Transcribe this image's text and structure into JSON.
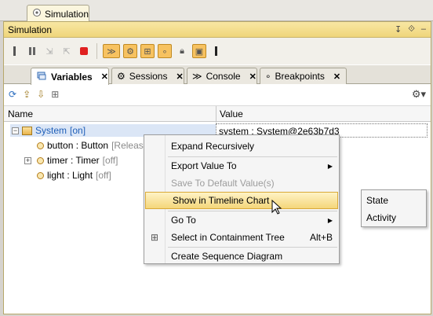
{
  "doc_tab": {
    "label": "Simulation",
    "icon": "simulation-icon"
  },
  "panel": {
    "title": "Simulation",
    "title_icons": [
      "pin-icon",
      "restore-icon",
      "minimize-icon"
    ]
  },
  "toolbar": {
    "buttons": [
      "step-back",
      "pause",
      "step-into",
      "step-over",
      "stop",
      "auto-animate",
      "animate",
      "trigger",
      "scenario",
      "lock",
      "record",
      "more"
    ]
  },
  "tabs": [
    {
      "label": "Variables",
      "icon": "variables-icon",
      "active": true
    },
    {
      "label": "Sessions",
      "icon": "sessions-icon",
      "active": false
    },
    {
      "label": "Console",
      "icon": "console-icon",
      "active": false
    },
    {
      "label": "Breakpoints",
      "icon": "breakpoints-icon",
      "active": false
    }
  ],
  "table": {
    "columns": [
      "Name",
      "Value"
    ],
    "rows": [
      {
        "name": "System",
        "extra": "[on]",
        "value": "system : System@2e63b7d3",
        "expanded": true
      },
      {
        "name": "button : Button",
        "extra": "[Release",
        "value": ""
      },
      {
        "name": "timer : Timer",
        "extra": "[off]",
        "value": ""
      },
      {
        "name": "light : Light",
        "extra": "[off]",
        "value": ""
      }
    ]
  },
  "context_menu": {
    "items": [
      {
        "label": "Expand Recursively"
      },
      {
        "label": "Export Value To",
        "submenu": true
      },
      {
        "label": "Save To Default Value(s)",
        "disabled": true
      },
      {
        "label": "Show in Timeline Chart",
        "highlighted": true
      },
      {
        "label": "Go To",
        "submenu": true
      },
      {
        "label": "Select in Containment Tree",
        "accelerator": "Alt+B",
        "icon": "containment-tree-icon"
      },
      {
        "label": "Create Sequence Diagram"
      }
    ]
  },
  "submenu": {
    "items": [
      "State",
      "Activity"
    ]
  },
  "colors": {
    "accent": "#f7c260",
    "title_bar": "#f3dc8a",
    "highlight": "#f4d67a"
  }
}
